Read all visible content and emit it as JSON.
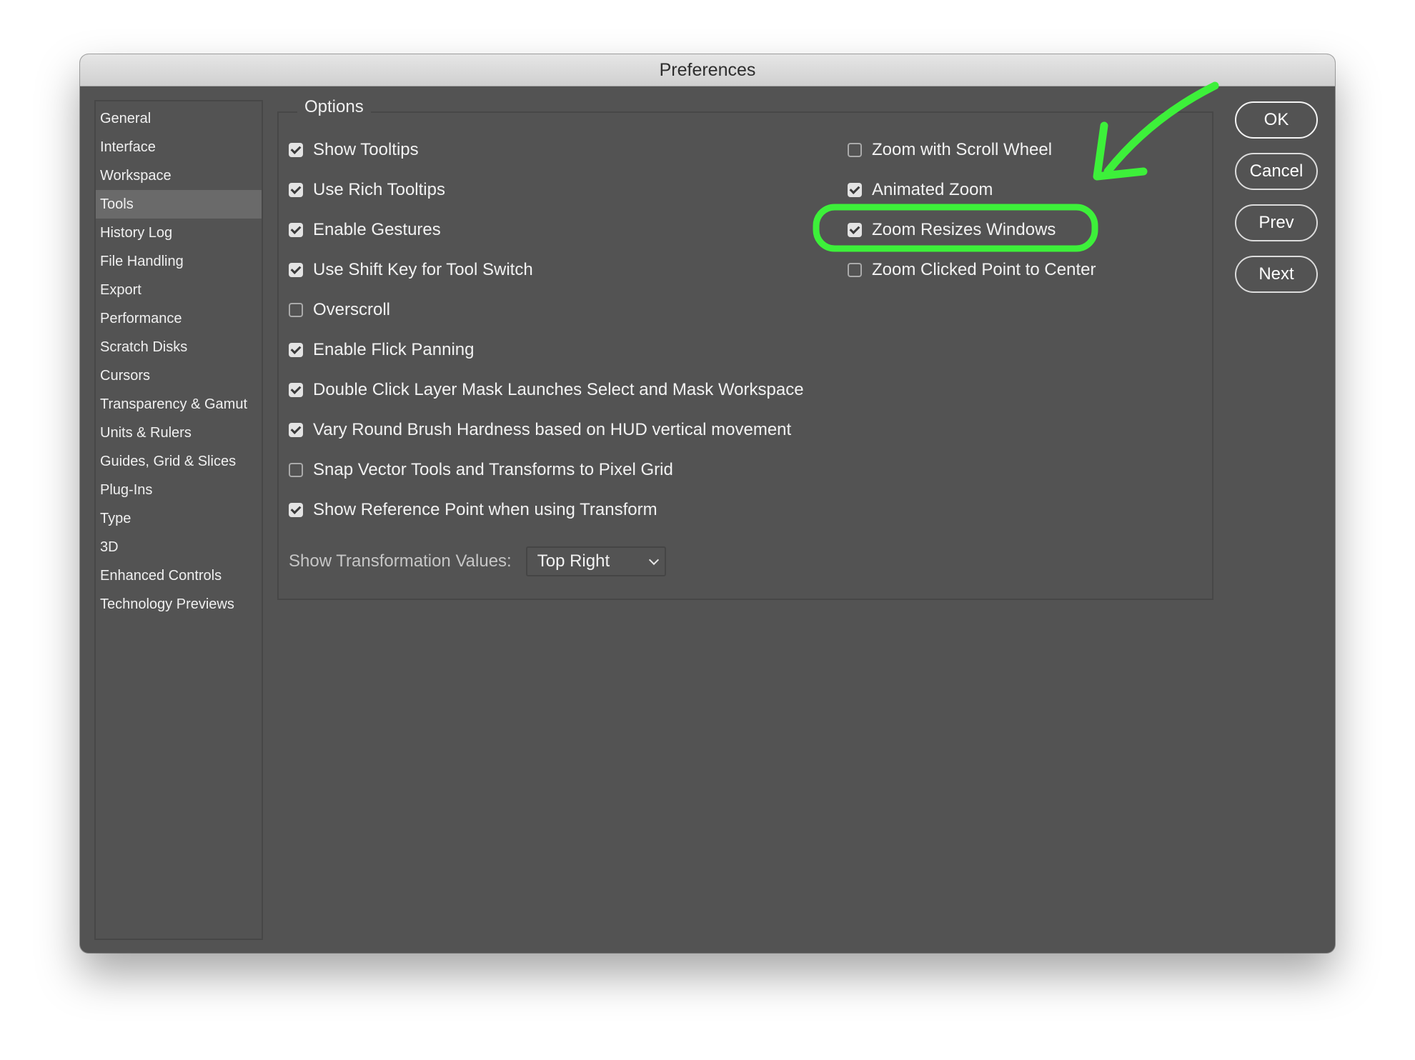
{
  "window": {
    "title": "Preferences"
  },
  "sidebar": {
    "items": [
      {
        "label": "General",
        "selected": false
      },
      {
        "label": "Interface",
        "selected": false
      },
      {
        "label": "Workspace",
        "selected": false
      },
      {
        "label": "Tools",
        "selected": true
      },
      {
        "label": "History Log",
        "selected": false
      },
      {
        "label": "File Handling",
        "selected": false
      },
      {
        "label": "Export",
        "selected": false
      },
      {
        "label": "Performance",
        "selected": false
      },
      {
        "label": "Scratch Disks",
        "selected": false
      },
      {
        "label": "Cursors",
        "selected": false
      },
      {
        "label": "Transparency & Gamut",
        "selected": false
      },
      {
        "label": "Units & Rulers",
        "selected": false
      },
      {
        "label": "Guides, Grid & Slices",
        "selected": false
      },
      {
        "label": "Plug-Ins",
        "selected": false
      },
      {
        "label": "Type",
        "selected": false
      },
      {
        "label": "3D",
        "selected": false
      },
      {
        "label": "Enhanced Controls",
        "selected": false
      },
      {
        "label": "Technology Previews",
        "selected": false
      }
    ]
  },
  "options": {
    "label": "Options",
    "left_column": [
      {
        "label": "Show Tooltips",
        "checked": true
      },
      {
        "label": "Use Rich Tooltips",
        "checked": true
      },
      {
        "label": "Enable Gestures",
        "checked": true
      },
      {
        "label": "Use Shift Key for Tool Switch",
        "checked": true
      },
      {
        "label": "Overscroll",
        "checked": false
      },
      {
        "label": "Enable Flick Panning",
        "checked": true
      },
      {
        "label": "Double Click Layer Mask Launches Select and Mask Workspace",
        "checked": true
      },
      {
        "label": "Vary Round Brush Hardness based on HUD vertical movement",
        "checked": true
      },
      {
        "label": "Snap Vector Tools and Transforms to Pixel Grid",
        "checked": false
      },
      {
        "label": "Show Reference Point when using Transform",
        "checked": true
      }
    ],
    "right_column": [
      {
        "label": "Zoom with Scroll Wheel",
        "checked": false
      },
      {
        "label": "Animated Zoom",
        "checked": true
      },
      {
        "label": "Zoom Resizes Windows",
        "checked": true
      },
      {
        "label": "Zoom Clicked Point to Center",
        "checked": false
      }
    ],
    "transformation": {
      "label": "Show Transformation Values:",
      "value": "Top Right"
    }
  },
  "buttons": {
    "ok": "OK",
    "cancel": "Cancel",
    "prev": "Prev",
    "next": "Next"
  },
  "colors": {
    "dialog_bg": "#535353",
    "selected_item": "#6a6a6a",
    "annotation_highlight": "#3df03a"
  },
  "annotation": {
    "highlighted_option": "Zoom Resizes Windows"
  }
}
